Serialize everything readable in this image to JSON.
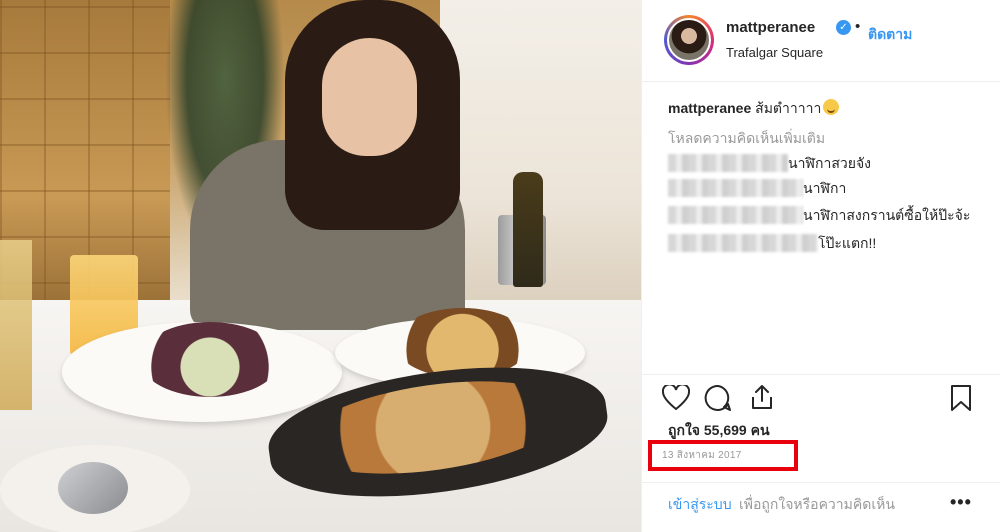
{
  "post": {
    "username": "mattperanee",
    "follow_label": "ติดตาม",
    "location": "Trafalgar Square",
    "caption_user": "mattperanee",
    "caption_text": "ส้มตำาาาา",
    "load_more_comments": "โหลดความคิดเห็นเพิ่มเติม",
    "comments": [
      {
        "text": "นาฬิกาสวยจัง"
      },
      {
        "text": "นาฬิกา"
      },
      {
        "text": "นาฬิกาสงกรานต์ซื้อให้ป๊ะจ้ะ"
      },
      {
        "text": "โป๊ะแตก!!"
      }
    ],
    "likes_text": "ถูกใจ 55,699 คน",
    "date": "13 สิงหาคม 2017",
    "login_link": "เข้าสู่ระบบ",
    "login_rest": " เพื่อถูกใจหรือความคิดเห็น",
    "more_options": "•••"
  },
  "colors": {
    "link_blue": "#3897f0",
    "highlight_red": "#e8000c",
    "muted_gray": "#999999"
  },
  "icons": [
    "heart-icon",
    "comment-icon",
    "share-icon",
    "bookmark-icon",
    "verified-badge-icon",
    "emoji-icon",
    "more-options-icon"
  ]
}
